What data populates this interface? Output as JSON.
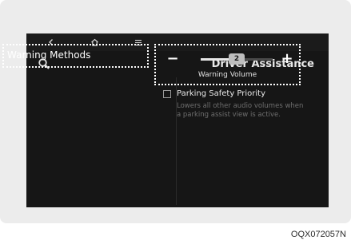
{
  "screen": {
    "title": "Driver Assistance",
    "nav": {
      "back_icon": "chevron-left-icon",
      "home_icon": "home-icon",
      "menu_icon": "menu-icon"
    },
    "search_icon": "search-icon"
  },
  "menu": {
    "items": [
      {
        "label": "Warning Methods"
      }
    ]
  },
  "volume": {
    "label": "Warning Volume",
    "value": "2",
    "level_fraction": 0.5,
    "minus": "−",
    "plus": "+"
  },
  "parking": {
    "checked": false,
    "label": "Parking Safety Priority",
    "description": "Lowers all other audio volumes when a parking assist view is active."
  },
  "figure_code": "OQX072057N",
  "colors": {
    "screen_bg": "#161616",
    "text": "#e8e8e8",
    "muted": "#6e6e6e"
  }
}
